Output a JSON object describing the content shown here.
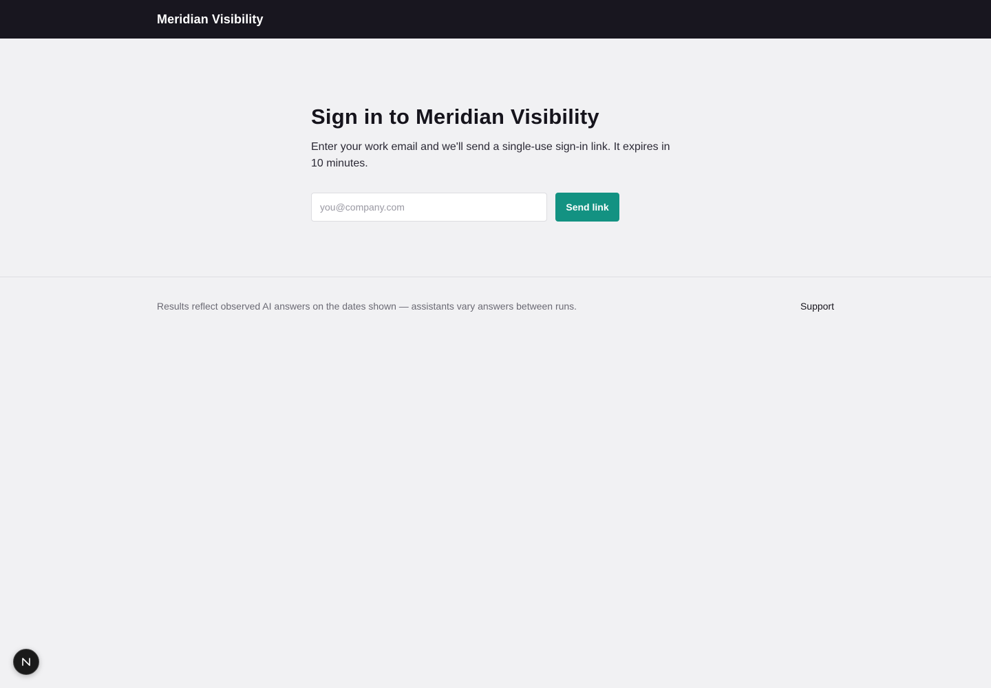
{
  "header": {
    "brand": "Meridian Visibility"
  },
  "signin": {
    "title": "Sign in to Meridian Visibility",
    "description": "Enter your work email and we'll send a single-use sign-in link. It expires in 10 minutes.",
    "email_placeholder": "you@company.com",
    "email_value": "",
    "submit_label": "Send link"
  },
  "footer": {
    "note": "Results reflect observed AI answers on the dates shown — assistants vary answers between runs.",
    "support_label": "Support"
  },
  "dev_badge": {
    "icon": "n-logo-icon"
  },
  "colors": {
    "topbar": "#18161f",
    "accent": "#139282",
    "background": "#f1f1f3"
  }
}
